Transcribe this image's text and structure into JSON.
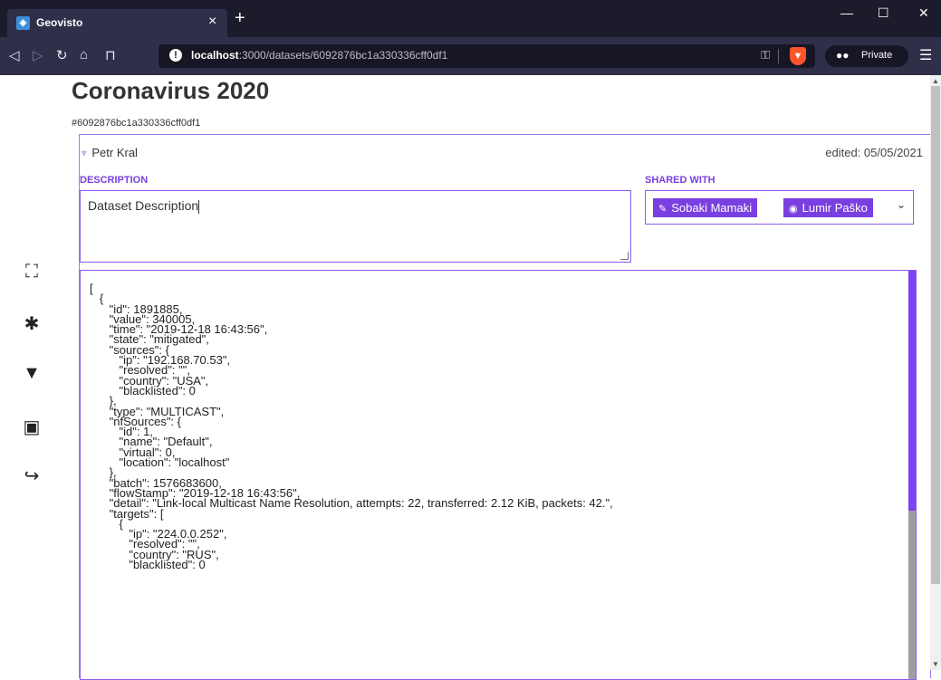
{
  "browser": {
    "tab_title": "Geovisto",
    "tab_close": "×",
    "new_tab": "+",
    "url_host": "localhost",
    "url_path": ":3000/datasets/6092876bc1a330336cff0df1",
    "private_label": "Private",
    "window_controls": {
      "minimize": "—",
      "maximize": "☐",
      "close": "✕"
    }
  },
  "sidebar": {
    "icons": [
      "brain-icon",
      "puzzle-icon",
      "presentation-icon",
      "id-badge-icon",
      "logout-icon"
    ]
  },
  "dataset": {
    "title": "Coronavirus 2020",
    "id": "#6092876bc1a330336cff0df1",
    "owner": "Petr Kral",
    "edited": "edited: 05/05/2021",
    "description_label": "DESCRIPTION",
    "description": "Dataset Description",
    "shared_label": "SHARED WITH",
    "shared_with": [
      {
        "name": "Sobaki Mamaki",
        "permission": "edit"
      },
      {
        "name": "Lumir Paško",
        "permission": "view"
      }
    ]
  },
  "json_content": "[\n   {\n      \"id\": 1891885,\n      \"value\": 340005,\n      \"time\": \"2019-12-18 16:43:56\",\n      \"state\": \"mitigated\",\n      \"sources\": {\n         \"ip\": \"192.168.70.53\",\n         \"resolved\": \"\",\n         \"country\": \"USA\",\n         \"blacklisted\": 0\n      },\n      \"type\": \"MULTICAST\",\n      \"nfSources\": {\n         \"id\": 1,\n         \"name\": \"Default\",\n         \"virtual\": 0,\n         \"location\": \"localhost\"\n      },\n      \"batch\": 1576683600,\n      \"flowStamp\": \"2019-12-18 16:43:56\",\n      \"detail\": \"Link-local Multicast Name Resolution, attempts: 22, transferred: 2.12 KiB, packets: 42.\",\n      \"targets\": [\n         {\n            \"ip\": \"224.0.0.252\",\n            \"resolved\": \"\",\n            \"country\": \"RUS\",\n            \"blacklisted\": 0"
}
